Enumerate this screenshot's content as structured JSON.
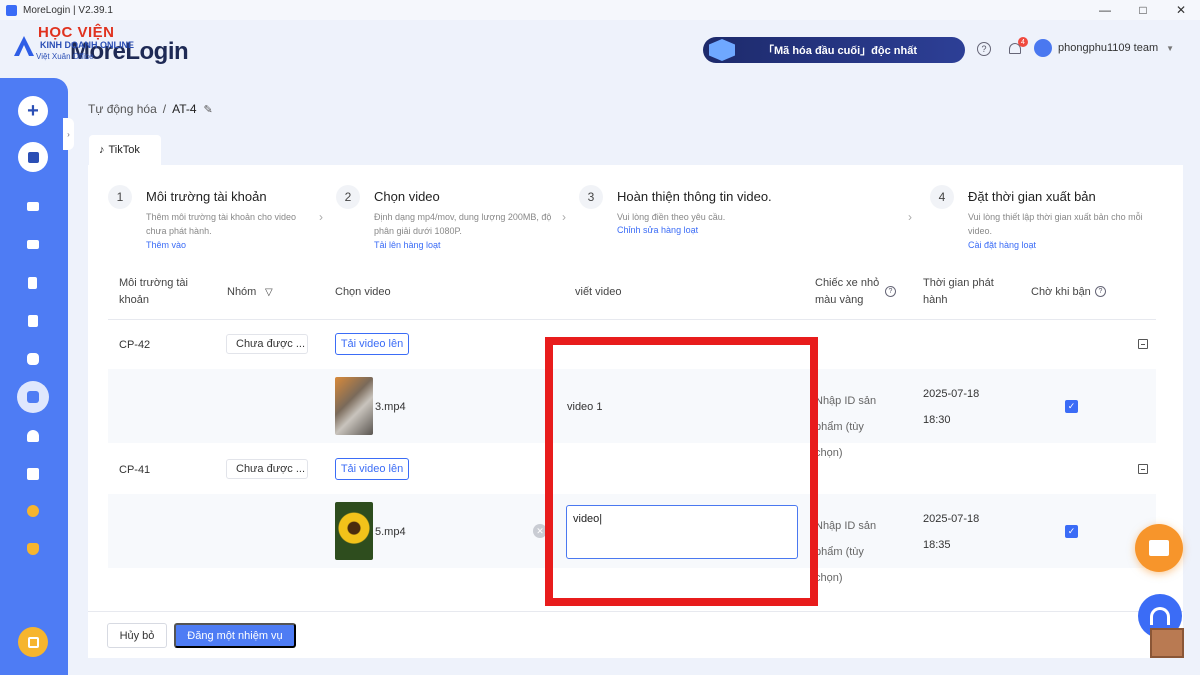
{
  "window": {
    "title": "MoreLogin | V2.39.1",
    "minimize": "—",
    "maximize": "□",
    "close": "✕"
  },
  "header": {
    "watermark_line1": "HỌC VIỆN",
    "watermark_line2": "KINH DOANH ONLINE",
    "watermark_line3": "Việt Xuân Office",
    "logo_text": "MoreLogin",
    "banner_text": "「Mã hóa đầu cuối」độc nhất",
    "help_icon": "?",
    "notification_count": "4",
    "username": "phongphu1109 team",
    "caret": "▼"
  },
  "sidebar": {
    "add_symbol": "+",
    "icons": [
      "add-icon",
      "browser-icon",
      "grid-icon",
      "list-icon",
      "document-icon",
      "trash-icon",
      "puzzle-icon",
      "robot-icon",
      "team-icon",
      "extension-icon",
      "clock-icon",
      "heart-icon",
      "bookmark-icon"
    ],
    "collapse_symbol": "›"
  },
  "breadcrumb": {
    "parent": "Tự động hóa",
    "separator": "/",
    "current": "AT-4",
    "edit_icon": "✎"
  },
  "tab": {
    "icon": "♪",
    "label": "TikTok"
  },
  "steps": [
    {
      "num": "1",
      "title": "Môi trường tài khoản",
      "desc": "Thêm môi trường tài khoản cho video chưa phát hành.",
      "link": "Thêm vào"
    },
    {
      "num": "2",
      "title": "Chọn video",
      "desc": "Định dạng mp4/mov, dung lượng 200MB, độ phân giải dưới 1080P.",
      "link": "Tải lên hàng loạt"
    },
    {
      "num": "3",
      "title": "Hoàn thiện thông tin video.",
      "desc": "Vui lòng điền theo yêu cầu.",
      "link": "Chỉnh sửa hàng loạt"
    },
    {
      "num": "4",
      "title": "Đặt thời gian xuất bản",
      "desc": "Vui lòng thiết lập thời gian xuất bản cho mỗi video.",
      "link": "Cài đặt hàng loạt"
    }
  ],
  "step_chevron": "›",
  "table": {
    "headers": {
      "env": "Môi trường tài khoản",
      "group": "Nhóm",
      "group_filter_icon": "▽",
      "video": "Chọn video",
      "write": "viết video",
      "cart": "Chiếc xe nhỏ màu vàng",
      "publish": "Thời gian phát hành",
      "wait": "Chờ khi bận",
      "info_icon": "?"
    },
    "rows": [
      {
        "env": "CP-42",
        "group": "Chưa được ...",
        "upload": "Tải video lên",
        "file": "3.mp4",
        "caption": "video 1",
        "product": "Nhập ID sản phẩm (tùy chọn)",
        "date": "2025-07-18",
        "time": "18:30",
        "checked": "✓",
        "collapse": "−"
      },
      {
        "env": "CP-41",
        "group": "Chưa được ...",
        "upload": "Tải video lên",
        "file": "5.mp4",
        "caption": "video|",
        "product": "Nhập ID sản phẩm (tùy chọn)",
        "date": "2025-07-18",
        "time": "18:35",
        "checked": "✓",
        "collapse": "−",
        "clear": "✕"
      }
    ]
  },
  "footer": {
    "cancel": "Hủy bỏ",
    "submit": "Đăng một nhiệm vụ"
  },
  "colors": {
    "accent": "#4e7cf4",
    "highlight": "#e81c1c",
    "gift": "#f7952b"
  }
}
